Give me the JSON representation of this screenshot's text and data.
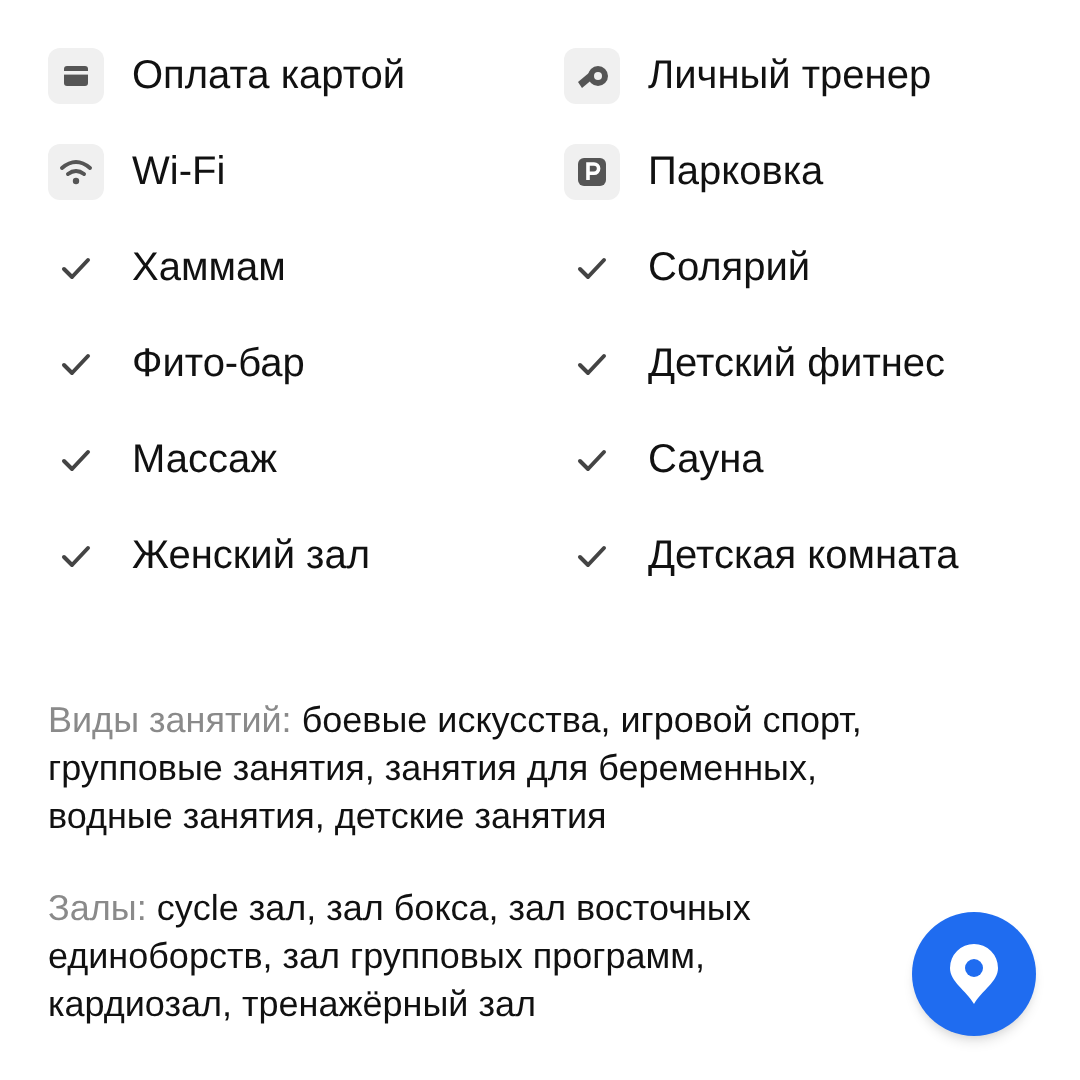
{
  "features": [
    {
      "label": "Оплата картой",
      "kind": "card"
    },
    {
      "label": "Личный тренер",
      "kind": "whistle"
    },
    {
      "label": "Wi-Fi",
      "kind": "wifi"
    },
    {
      "label": "Парковка",
      "kind": "parking"
    },
    {
      "label": "Хаммам",
      "kind": "check"
    },
    {
      "label": "Солярий",
      "kind": "check"
    },
    {
      "label": "Фито-бар",
      "kind": "check"
    },
    {
      "label": "Детский фитнес",
      "kind": "check"
    },
    {
      "label": "Массаж",
      "kind": "check"
    },
    {
      "label": "Сауна",
      "kind": "check"
    },
    {
      "label": "Женский зал",
      "kind": "check"
    },
    {
      "label": "Детская комната",
      "kind": "check"
    }
  ],
  "details": [
    {
      "label": "Виды занятий:",
      "text": "боевые искусства, игровой спорт, групповые занятия, занятия для беременных, водные занятия, детские занятия"
    },
    {
      "label": "Залы:",
      "text": "cycle зал, зал бокса, зал восточных единоборств, зал групповых программ, кардиозал, тренажёрный зал"
    }
  ]
}
